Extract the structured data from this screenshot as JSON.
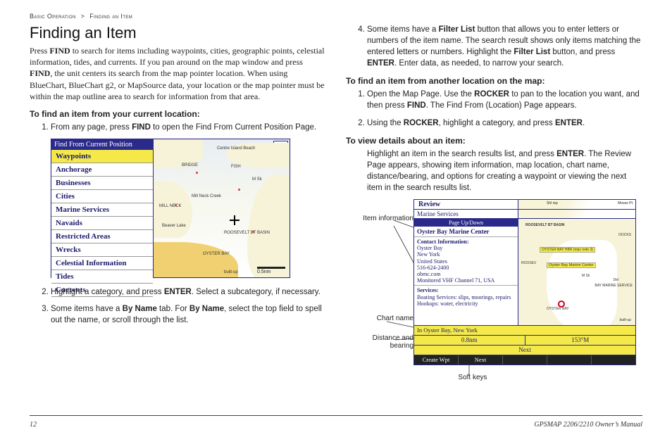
{
  "breadcrumb": {
    "a": "Basic Operation",
    "sep": ">",
    "b": "Finding an Item"
  },
  "h1": "Finding an Item",
  "intro_parts": {
    "p1a": "Press ",
    "p1b": "FIND",
    "p1c": " to search for items including waypoints, cities, geographic points, celestial information, tides, and currents. If you pan around on the map window and press ",
    "p1d": "FIND",
    "p1e": ", the unit centers its search from the map pointer location. When using BlueChart, BlueChart g2, or MapSource data, your location or the map pointer must be within the map outline area to search for information from that area."
  },
  "sub1": "To find an item from your current location:",
  "steps1": {
    "s1a": "From any page, press ",
    "s1b": "FIND",
    "s1c": " to open the Find From Current Position Page.",
    "s2a": "Highlight a category, and press ",
    "s2b": "ENTER",
    "s2c": ". Select a subcategory, if necessary.",
    "s3a": "Some items have a ",
    "s3b": "By Name",
    "s3c": " tab. For ",
    "s3d": "By Name",
    "s3e": ", select the top field to spell out the name, or scroll through the list."
  },
  "fig1": {
    "title": "Find From Current Position",
    "items": [
      "Waypoints",
      "Anchorage",
      "Businesses",
      "Cities",
      "Marine Services",
      "Navaids",
      "Restricted Areas",
      "Wrecks",
      "Celestial Information",
      "Tides",
      "Currents"
    ],
    "depth": "3.0",
    "scale": "0.5nm",
    "labels": [
      "Centre Island Beach",
      "BRIDGE",
      "FISH",
      "M Sk",
      "MILL NECK",
      "Mill Neck Creek",
      "Beaver Lake",
      "ROOSEVELT BT BASIN",
      "OYSTER BAY",
      "built-up"
    ]
  },
  "right": {
    "s4a": "Some items have a ",
    "s4b": "Filter List",
    "s4c": " button that allows you to enter letters or numbers of the item name. The search result shows only items matching the entered letters or numbers. Highlight the ",
    "s4d": "Filter List",
    "s4e": " button, and press ",
    "s4f": "ENTER",
    "s4g": ". Enter data, as needed, to narrow your search."
  },
  "sub2": "To find an item from another location on the map:",
  "steps2": {
    "s1a": "Open the Map Page. Use the ",
    "s1b": "ROCKER",
    "s1c": " to pan to the location you want, and then press ",
    "s1d": "FIND",
    "s1e": ". The Find From (Location) Page appears.",
    "s2a": "Using the ",
    "s2b": "ROCKER",
    "s2c": ", highlight a category, and press ",
    "s2d": "ENTER",
    "s2e": "."
  },
  "sub3": "To view details about an item:",
  "view_parts": {
    "a": "Highlight an item in the search results list, and press ",
    "b": "ENTER",
    "c": ". The Review Page appears, showing item information, map location, chart name, distance/bearing, and options for creating a waypoint or viewing the next item in the search results list."
  },
  "fig2": {
    "review": "Review",
    "tab": "Marine Services",
    "pud": "Page Up/Down",
    "name": "Oyster Bay Marine Center",
    "contact_h": "Contact Information:",
    "contact": "Oyster Bay\nNew York\nUnited States\n516-624-2400\nobmc.com\nMonitored VHF Channel 71, USA",
    "services_h": "Services:",
    "services": "Boating Services: slips, moorings, repairs\nHookups: water, electricity",
    "chart": "In Oyster Bay, New York",
    "dist": "0.8nm",
    "brg": "153°M",
    "next": "Next",
    "soft1": "Create Wpt",
    "soft2": "Next",
    "maplabels": [
      "Shl rep",
      "Moses Pt",
      "ROOSEVELT BT BASIN",
      "DOCKS",
      "ROOSEV",
      "Oyster Bay Marine Center",
      "M Sk",
      "BAY MARINE SERVICE",
      "Del",
      "built-up",
      "OYSTER BAY",
      "OYSTER BAY HBR (mpc note 3)"
    ]
  },
  "callouts": {
    "item_info": "Item information",
    "chart_name": "Chart name",
    "dist_bear": "Distance and bearing",
    "soft_keys": "Soft keys"
  },
  "footer": {
    "page": "12",
    "manual": "GPSMAP 2206/2210 Owner’s Manual"
  }
}
